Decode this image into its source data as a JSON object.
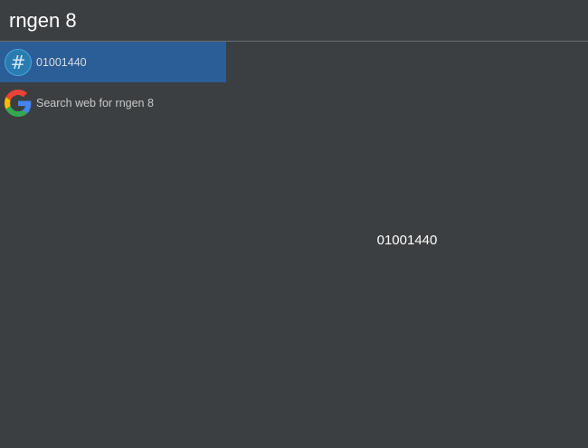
{
  "search": {
    "query": "rngen 8"
  },
  "results": [
    {
      "label": "01001440",
      "icon": "hash-icon",
      "selected": true
    },
    {
      "label": "Search web for rngen 8",
      "icon": "google-icon",
      "selected": false
    }
  ],
  "preview": {
    "value": "01001440"
  },
  "colors": {
    "background": "#3c3f41",
    "selected": "#2b5d96",
    "divider": "#6b6e70"
  }
}
